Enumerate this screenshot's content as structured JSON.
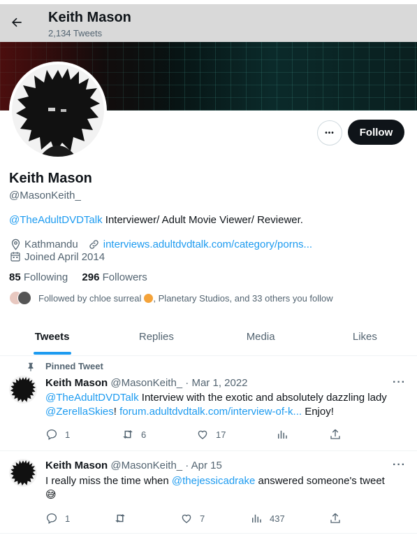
{
  "header": {
    "title": "Keith Mason",
    "tweet_count": "2,134 Tweets"
  },
  "profile": {
    "name": "Keith Mason",
    "handle": "@MasonKeith_",
    "more_label": "•••",
    "follow_label": "Follow",
    "bio_mention": "@TheAdultDVDTalk",
    "bio_text": " Interviewer/ Adult Movie Viewer/ Reviewer.",
    "location": "Kathmandu",
    "website": "interviews.adultdvdtalk.com/category/porns...",
    "joined": "Joined April 2014",
    "following_count": "85",
    "following_label": "Following",
    "followers_count": "296",
    "followers_label": "Followers",
    "followed_by": "Followed by chloe surreal",
    "followed_by_rest": ", Planetary Studios, and 33 others you follow"
  },
  "tabs": [
    {
      "label": "Tweets"
    },
    {
      "label": "Replies"
    },
    {
      "label": "Media"
    },
    {
      "label": "Likes"
    }
  ],
  "tweets": [
    {
      "pinned_label": "Pinned Tweet",
      "name": "Keith Mason",
      "handle": "@MasonKeith_",
      "date": " · Mar 1, 2022",
      "mention1": "@TheAdultDVDTalk",
      "text1": " Interview with the exotic and absolutely dazzling lady",
      "mention2": "@ZerellaSkies",
      "text2": "! ",
      "link": "forum.adultdvdtalk.com/interview-of-k...",
      "text3": " Enjoy!",
      "replies": "1",
      "retweets": "6",
      "likes": "17"
    },
    {
      "name": "Keith Mason",
      "handle": "@MasonKeith_",
      "date": " · Apr 15",
      "text1": "I really miss the time when ",
      "mention1": "@thejessicadrake",
      "text2": " answered someone's tweet",
      "emoji": "😅",
      "replies": "1",
      "likes": "7",
      "views": "437"
    }
  ],
  "colors": {
    "accent": "#1d9bf0",
    "text": "#0f1419",
    "muted": "#536471",
    "header_bg": "#d9d9d9"
  }
}
